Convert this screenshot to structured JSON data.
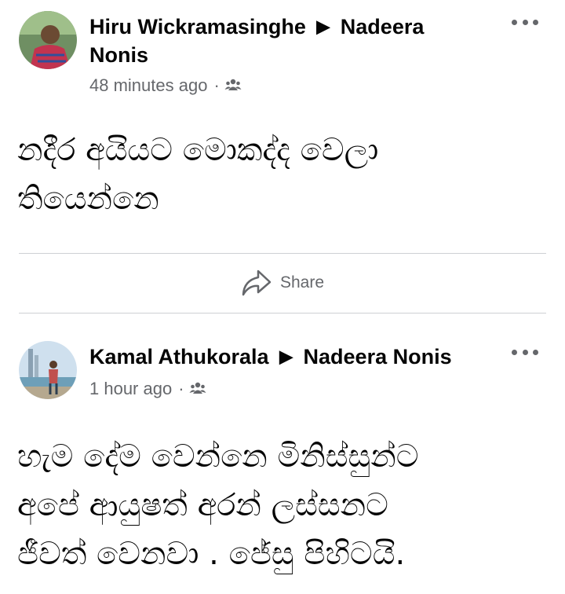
{
  "posts": [
    {
      "author": "Hiru Wickramasinghe",
      "separator": "▶",
      "target": "Nadeera Nonis",
      "time": "48 minutes ago",
      "audience_icon": "friends-icon",
      "text": "නදීර අයියට මොකද්ද වෙලා\nතියෙන්නෙ"
    },
    {
      "author": "Kamal Athukorala",
      "separator": "▶",
      "target": "Nadeera Nonis",
      "time": "1 hour ago",
      "audience_icon": "friends-icon",
      "text": "හැම දේම වෙන්නෙ මිනිස්සුන්ට\nඅපේ ආයුෂත් අරන් ලස්සනට\nජීවත් වෙනවා . ජේසු පිහිටයි."
    }
  ],
  "actions": {
    "share_label": "Share"
  },
  "colors": {
    "text": "#050505",
    "muted": "#65676b",
    "divider": "#ced0d4"
  }
}
